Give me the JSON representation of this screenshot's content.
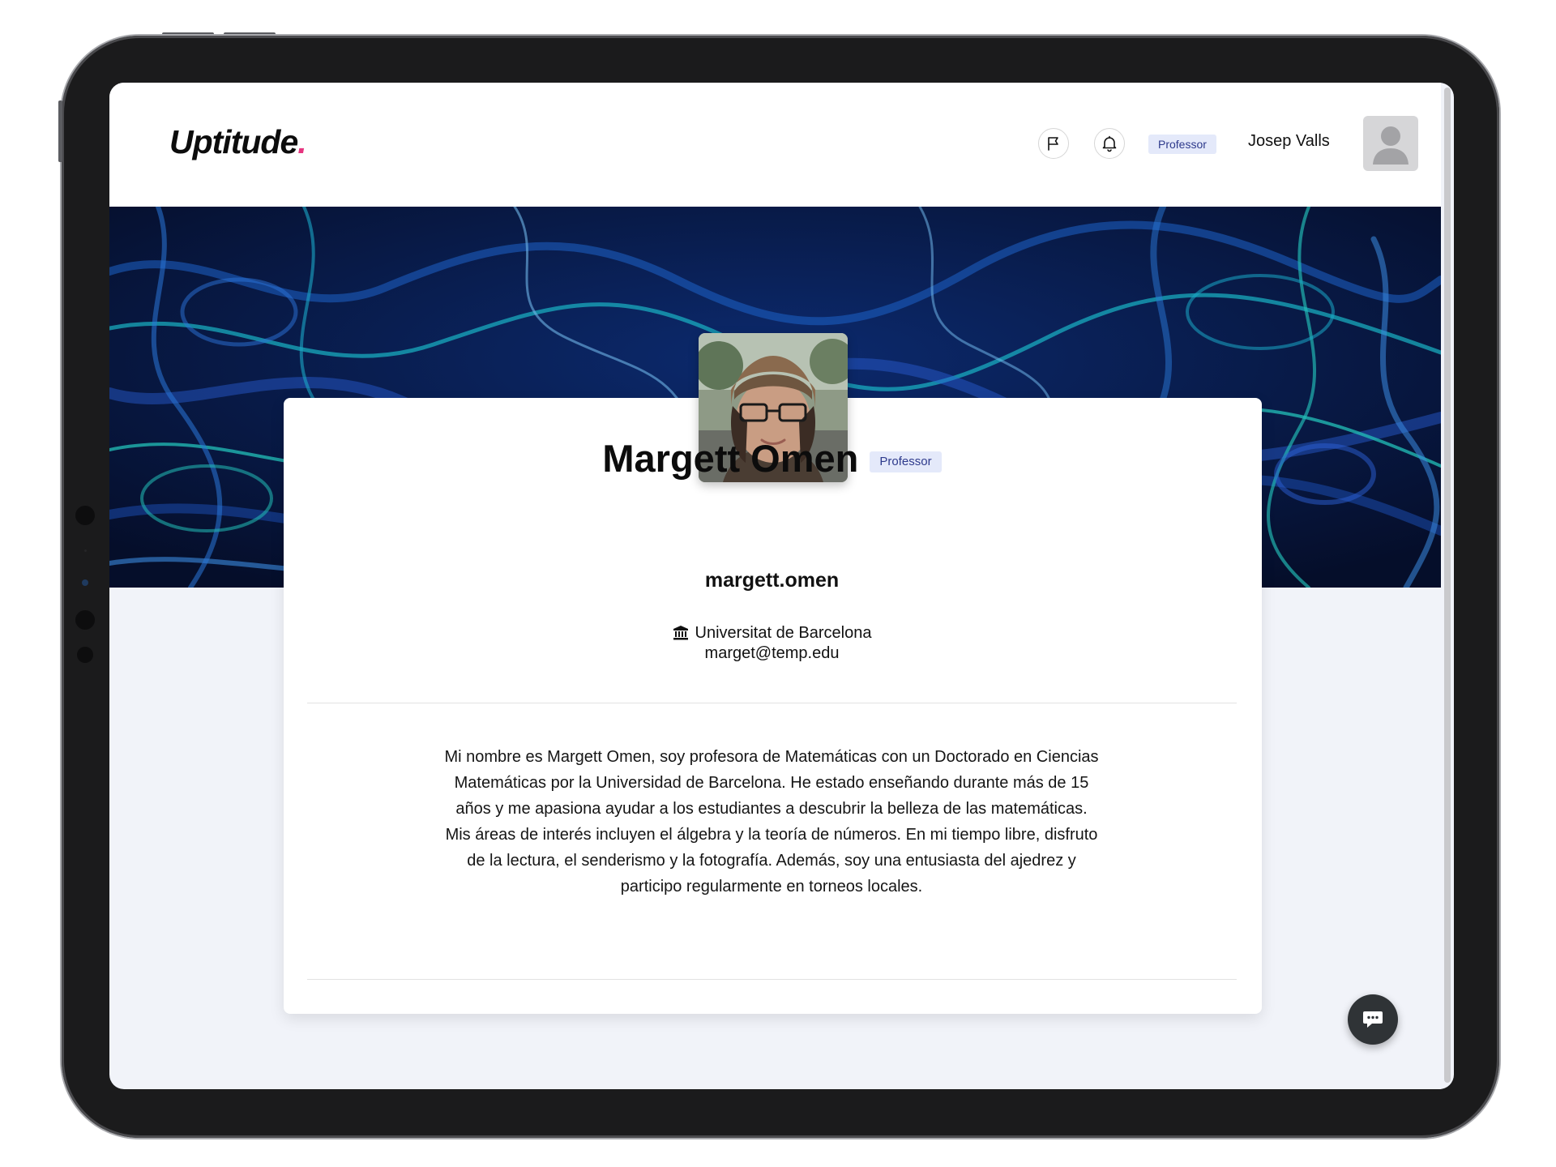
{
  "app": {
    "logo_text": "Uptitude",
    "logo_dot": ".",
    "brand_accent": "#e6347f"
  },
  "header": {
    "flag_icon": "flag-icon",
    "bell_icon": "bell-icon",
    "role_badge": "Professor",
    "user_name": "Josep Valls",
    "avatar_icon": "user-placeholder-icon"
  },
  "profile": {
    "name": "Margett Omen",
    "role_badge": "Professor",
    "username": "margett.omen",
    "institution_icon": "bank-icon",
    "institution": "Universitat de Barcelona",
    "email": "marget@temp.edu",
    "bio": "Mi nombre es Margett Omen, soy profesora de Matemáticas con un Doctorado en Ciencias Matemáticas por la Universidad de Barcelona. He estado enseñando durante más de 15 años y me apasiona ayudar a los estudiantes a descubrir la belleza de las matemáticas. Mis áreas de interés incluyen el álgebra y la teoría de números. En mi tiempo libre, disfruto de la lectura, el senderismo y la fotografía. Además, soy una entusiasta del ajedrez y participo regularmente en torneos locales."
  },
  "chat": {
    "icon": "chat-bubble-icon"
  },
  "colors": {
    "badge_bg": "#e4e9fa",
    "badge_text": "#2e3a8c",
    "page_bg": "#f1f3f9",
    "banner_bg": "#07153a",
    "fab_bg": "#2f3336"
  }
}
